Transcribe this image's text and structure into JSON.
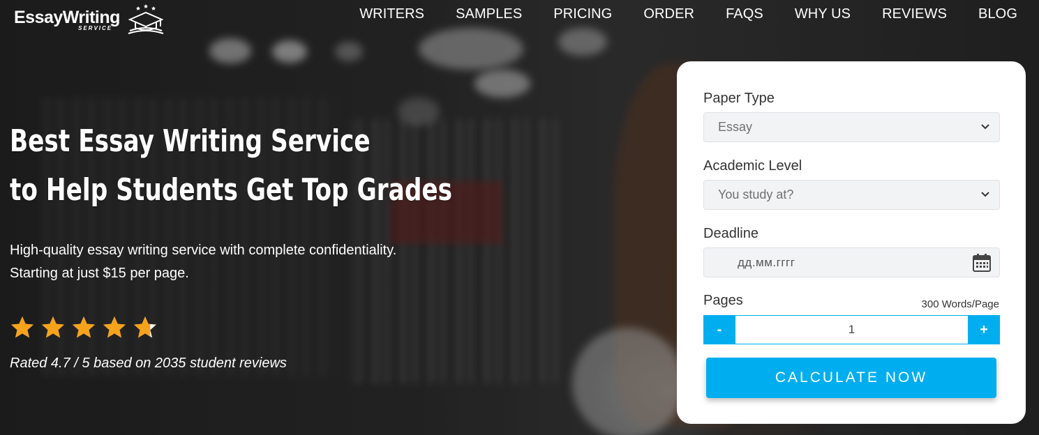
{
  "logo": {
    "text": "EssayWriting",
    "subtext": "SERVICE"
  },
  "nav": {
    "items": [
      {
        "label": "WRITERS"
      },
      {
        "label": "SAMPLES"
      },
      {
        "label": "PRICING"
      },
      {
        "label": "ORDER"
      },
      {
        "label": "FAQS"
      },
      {
        "label": "WHY US"
      },
      {
        "label": "REVIEWS"
      },
      {
        "label": "BLOG"
      }
    ]
  },
  "hero": {
    "title_line1": "Best Essay Writing Service",
    "title_line2": "to Help Students Get Top Grades",
    "subtitle_line1": "High-quality essay writing service with complete confidentiality.",
    "subtitle_line2": "Starting at just $15 per page.",
    "rating_value": 4.7,
    "rating_max": 5,
    "rating_text": "Rated 4.7 / 5 based on 2035 student reviews"
  },
  "calculator": {
    "paper_type_label": "Paper Type",
    "paper_type_value": "Essay",
    "academic_level_label": "Academic Level",
    "academic_level_placeholder": "You study at?",
    "deadline_label": "Deadline",
    "deadline_placeholder": "дд.мм.гггг",
    "pages_label": "Pages",
    "words_per_page": "300 Words/Page",
    "minus_label": "-",
    "plus_label": "+",
    "pages_value": "1",
    "calculate_label": "CALCULATE NOW"
  },
  "colors": {
    "accent": "#00aeef",
    "star": "#f7a21b"
  },
  "icons": [
    "graduation-cap-icon",
    "chevron-down-icon",
    "calendar-icon",
    "star-icon"
  ]
}
